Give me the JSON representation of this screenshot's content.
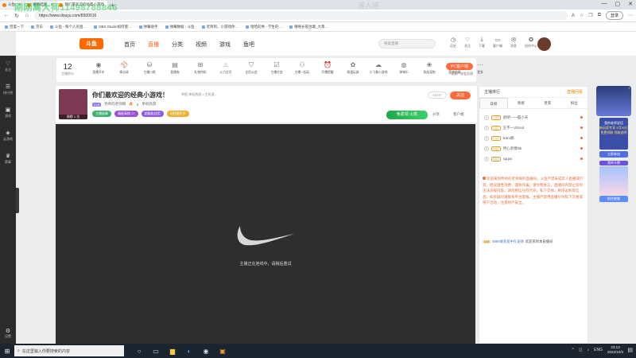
{
  "overlay": {
    "watermark": "刚刚离大师11498788846",
    "watermark2": "道人道"
  },
  "browser": {
    "tabs": [
      {
        "label": "斗鱼"
      },
      {
        "label": "搜索结果"
      },
      {
        "label": "我们最欢迎的经典小游戏",
        "active": true
      }
    ],
    "new_tab": "+",
    "url": "https://www.douyu.com/8500016",
    "login_label": "登录",
    "bookmarks": [
      "百度一下",
      "京东",
      "斗鱼 - 每个人的直…",
      "OBS Studio如何使…",
      "弹幕助手",
      "弹幕数据 - 斗鱼",
      "老师到，小游戏你…",
      "哈哈的秀 - 学生的…",
      "嘻嘻长夜池塘_大草…"
    ]
  },
  "sidebar": {
    "items": [
      {
        "icon": "heart-icon",
        "label": "关注"
      },
      {
        "icon": "list-icon",
        "label": "排行榜"
      },
      {
        "icon": "gamepad-icon",
        "label": "游戏"
      },
      {
        "icon": "controller-icon",
        "label": "云游戏"
      },
      {
        "icon": "trophy-icon",
        "label": "赛事"
      }
    ],
    "bottom_label": "设置"
  },
  "site": {
    "logo": "斗鱼",
    "nav": [
      "首页",
      "直播",
      "分类",
      "视频",
      "游戏",
      "鱼吧"
    ],
    "active_nav": "直播",
    "search_placeholder": "搜索直播",
    "header_icons": [
      "历史",
      "关注",
      "下载",
      "客户端",
      "消息",
      "创作中心"
    ]
  },
  "category_bar": {
    "count": "12",
    "count_label": "主播积分",
    "items": [
      "直播开车",
      "棒击球",
      "主播口袋",
      "直播卷",
      "礼物特权",
      "火力全开",
      "全民公会",
      "主播任务",
      "主播一起玩",
      "开播提醒",
      "捣蛋玩具",
      "小飞象小游戏",
      "弹弹乐",
      "贵族宠物",
      "荣誉勋章",
      "更多"
    ],
    "pc_button": "PC客户端",
    "pc_sub": "下载客户端看直播"
  },
  "stream": {
    "title": "你们最欢迎的经典小游戏！",
    "tag": "举报  单机热游  > 主机游...",
    "anchor_name": "乔师的老师啊",
    "level_badge": "Lv.5",
    "heat": "4",
    "category": "单机热游",
    "rank_label": "周榜 1 位",
    "tags": [
      "主播勋章",
      "福星高照 17",
      "超级粉丝团",
      "玩转嘉年华"
    ],
    "hot_value": "10747",
    "follow_label": "关注",
    "gift_button": "免费领 火箭",
    "share_label": "分享",
    "report_label": "客户端"
  },
  "video": {
    "loading_text": "主播正在连线中，请稍后重试"
  },
  "right_panel": {
    "top_left": "主播排行",
    "top_right": "直播回看",
    "tabs": [
      "日榜",
      "周榜",
      "贵宾",
      "粉丝"
    ],
    "active_tab": "日榜",
    "ranks": [
      {
        "idx": "1",
        "lv": "Lv33",
        "name": "退吧——喵小天"
      },
      {
        "idx": "2",
        "lv": "Lv27",
        "name": "王不—ViSoul"
      },
      {
        "idx": "3",
        "lv": "Lv22",
        "name": "Karo鹅"
      },
      {
        "idx": "4",
        "lv": "Lv19",
        "name": "伴心亲情Nk"
      },
      {
        "idx": "5",
        "lv": "Lv17",
        "name": "xqqxx"
      }
    ],
    "notice": "欢迎来到乔师的老师啊的直播间，斗鱼严禁未成年人直播或打赏。倡议理性消费，谨防诈骗，请文明发言，直播间内禁止任何违法违规内容。请勿相信任何代充、私下交易、刷单返利等信息，如有疑问请联系平台客服。主播严禁用直播引导私下交易或线下活动，注意财产安全。",
    "welcome_pill": "Lv3",
    "welcome_name": "8899收获爱中在发财",
    "welcome_text": "欢迎来到本直播间"
  },
  "ad": {
    "title": "我的老师说话",
    "box_text": "新玩家专享 4月30日 免费领取 领取说明",
    "btn1": "立即参加",
    "card_title": "我的卡牌",
    "btn2": "前往收集"
  },
  "taskbar": {
    "search_placeholder": "在这里输入你要搜索的内容",
    "time": "23:13",
    "date": "2022/10/3",
    "lang": "ENG"
  }
}
